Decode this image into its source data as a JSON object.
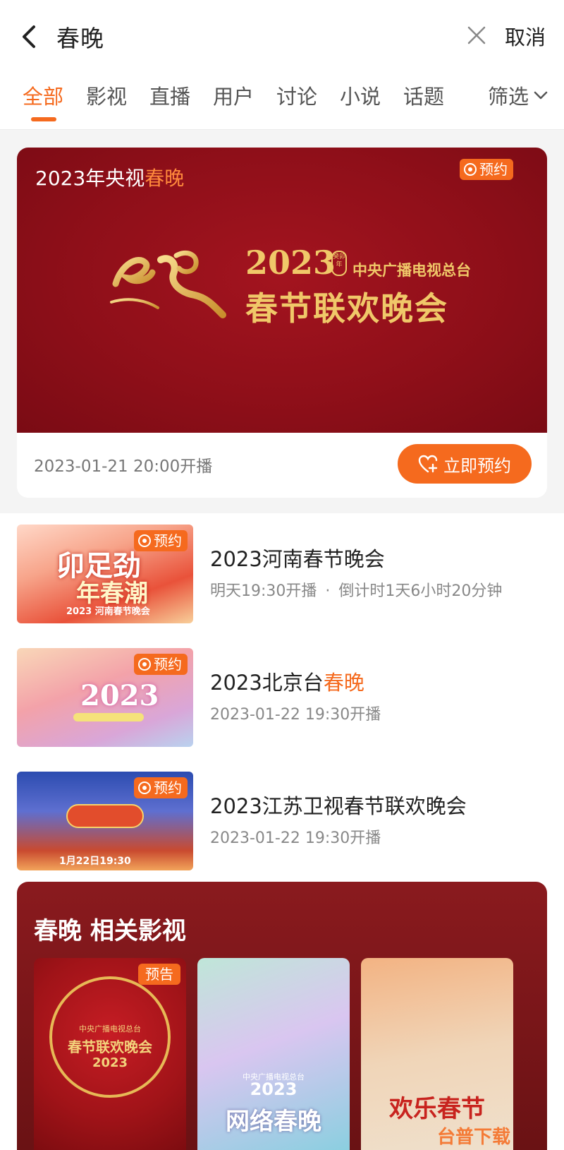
{
  "search": {
    "query": "春晚",
    "cancel_label": "取消"
  },
  "tabs": [
    {
      "label": "全部",
      "active": true
    },
    {
      "label": "影视"
    },
    {
      "label": "直播"
    },
    {
      "label": "用户"
    },
    {
      "label": "讨论"
    },
    {
      "label": "小说"
    },
    {
      "label": "话题"
    }
  ],
  "filter_label": "筛选",
  "featured": {
    "title_prefix": "2023年央视",
    "title_highlight": "春晚",
    "badge": "预约",
    "banner_year": "2023",
    "banner_seal": "癸卯年",
    "banner_org": "中央广播电视总台",
    "banner_name": "春节联欢晚会",
    "time": "2023-01-21 20:00开播",
    "reserve_label": "立即预约"
  },
  "results": [
    {
      "title": "2023河南春节晚会",
      "title_highlight": "",
      "badge": "预约",
      "meta": "明天19:30开播",
      "countdown": "倒计时1天6小时20分钟",
      "thumb_text": "2023 河南春节晚会"
    },
    {
      "title": "2023北京台",
      "title_highlight": "春晚",
      "badge": "预约",
      "meta": "2023-01-22 19:30开播",
      "countdown": "",
      "thumb_text": "2023"
    },
    {
      "title": "2023江苏卫视春节联欢晚会",
      "title_highlight": "",
      "badge": "预约",
      "meta": "2023-01-22 19:30开播",
      "countdown": "",
      "thumb_text": "1月22日19:30"
    }
  ],
  "related": {
    "title": "春晚 相关影视",
    "posters": [
      {
        "badge": "预告",
        "org": "中央广播电视总台",
        "name": "春节联欢晚会",
        "year": "2023"
      },
      {
        "badge": "",
        "org": "中央广播电视总台",
        "name": "网络春晚",
        "year": "2023"
      },
      {
        "badge": "",
        "org": "",
        "name": "欢乐春节",
        "year": ""
      }
    ]
  },
  "watermark": "台普下载",
  "colors": {
    "accent": "#f56a1e",
    "banner_red": "#8f0f19",
    "gold": "#f0c869"
  }
}
